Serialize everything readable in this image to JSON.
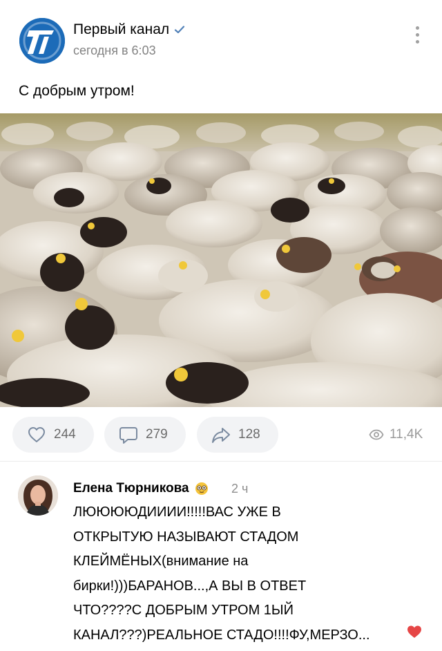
{
  "post": {
    "channel_name": "Первый канал",
    "time": "сегодня в 6:03",
    "text": "С добрым утром!",
    "logo_glyph": "1"
  },
  "actions": {
    "likes": "244",
    "comments": "279",
    "shares": "128",
    "views": "11,4K"
  },
  "comment": {
    "author": "Елена Тюрникова",
    "time": "2 ч",
    "text": "ЛЮЮЮЮДИИИИ!!!!!ВАС УЖЕ В\nОТКРЫТУЮ НАЗЫВАЮТ СТАДОМ\nКЛЕЙМЁНЫХ(внимание на\nбирки!)))БАРАНОВ...,А ВЫ В ОТВЕТ\nЧТО????С ДОБРЫМ УТРОМ 1ЫЙ\nКАНАЛ???)РЕАЛЬНОЕ СТАДО!!!!ФУ,МЕРЗО..."
  },
  "colors": {
    "brand_blue": "#1c6bb8",
    "verified": "#5181b8",
    "heart": "#e64646",
    "pill_bg": "#f2f3f5"
  },
  "icons": [
    "verified-icon",
    "more-icon",
    "like-icon",
    "comment-icon",
    "share-icon",
    "views-icon",
    "emoji-icon",
    "heart-icon"
  ]
}
